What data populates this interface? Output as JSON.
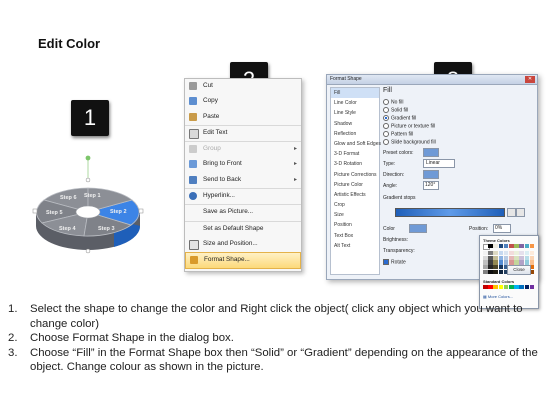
{
  "title": "Edit Color",
  "badges": [
    "1",
    "2",
    "3"
  ],
  "chart": {
    "labels": [
      "Step 1",
      "Step 2",
      "Step 3",
      "Step 4",
      "Step 5",
      "Step 6"
    ],
    "colors": {
      "top": "#8c8f96",
      "side": "#5b5e66",
      "highlight": "#3c84e6",
      "highlight_side": "#1f5fb9",
      "handle": "#7dc66b"
    }
  },
  "context_menu": {
    "items": [
      {
        "label": "Cut",
        "icon": "scissors-icon",
        "state": "normal"
      },
      {
        "label": "Copy",
        "icon": "copy-icon",
        "state": "normal"
      },
      {
        "label": "Paste",
        "icon": "paste-icon",
        "state": "normal"
      },
      {
        "label": "Edit Text",
        "icon": "edit-text-icon",
        "state": "normal"
      },
      {
        "label": "Group",
        "icon": "group-icon",
        "state": "disabled"
      },
      {
        "label": "Bring to Front",
        "icon": "bring-front-icon",
        "state": "normal"
      },
      {
        "label": "Send to Back",
        "icon": "send-back-icon",
        "state": "normal"
      },
      {
        "label": "Hyperlink...",
        "icon": "hyperlink-icon",
        "state": "normal"
      },
      {
        "label": "Save as Picture...",
        "icon": "none",
        "state": "normal"
      },
      {
        "label": "Set as Default Shape",
        "icon": "none",
        "state": "normal"
      },
      {
        "label": "Size and Position...",
        "icon": "size-icon",
        "state": "normal"
      },
      {
        "label": "Format Shape...",
        "icon": "format-shape-icon",
        "state": "highlighted"
      }
    ]
  },
  "dialog": {
    "title": "Format Shape",
    "nav": [
      "Fill",
      "Line Color",
      "Line Style",
      "Shadow",
      "Reflection",
      "Glow and Soft Edges",
      "3-D Format",
      "3-D Rotation",
      "Picture Corrections",
      "Picture Color",
      "Artistic Effects",
      "Crop",
      "Size",
      "Position",
      "Text Box",
      "Alt Text"
    ],
    "selected_nav": "Fill",
    "section": "Fill",
    "fill_options": [
      "No fill",
      "Solid fill",
      "Gradient fill",
      "Picture or texture fill",
      "Pattern fill"
    ],
    "selected_fill": "Gradient fill",
    "slide_bg": "Slide background fill",
    "preset_label": "Preset colors:",
    "type_label": "Type:",
    "type_value": "Linear",
    "direction_label": "Direction:",
    "angle_label": "Angle:",
    "angle_value": "120°",
    "stops_label": "Gradient stops",
    "color_label": "Color",
    "position_label": "Position:",
    "position_value": "0%",
    "brightness_label": "Brightness:",
    "transparency_label": "Transparency:",
    "rotate_label": "Rotate",
    "theme_colors": "Theme Colors",
    "standard_colors": "Standard Colors",
    "more_colors": "More Colors...",
    "close": "Close"
  },
  "steps": [
    {
      "n": "1.",
      "text": "Select the shape to change the color and Right click the object( click any object which you want to change color)"
    },
    {
      "n": "2.",
      "text": "Choose Format Shape in the dialog box."
    },
    {
      "n": "3.",
      "text": "Choose “Fill” in the Format Shape box then “Solid” or “Gradient” depending on the appearance of the object. Change colour as shown in the picture."
    }
  ]
}
